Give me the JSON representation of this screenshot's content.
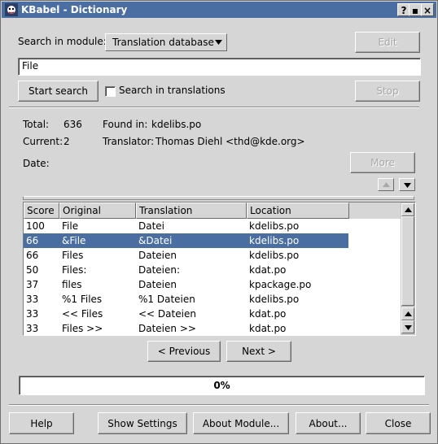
{
  "window": {
    "title": "KBabel - Dictionary",
    "title_buttons": [
      "?",
      "▪",
      "×"
    ]
  },
  "search": {
    "module_label": "Search in module:",
    "module_value": "Translation database",
    "query": "File",
    "edit_label": "Edit",
    "start_label": "Start search",
    "in_translations_label": "Search in translations",
    "in_translations_checked": false,
    "stop_label": "Stop"
  },
  "info": {
    "total_label": "Total:",
    "total_value": "636",
    "found_label": "Found in:",
    "found_value": "kdelibs.po",
    "current_label": "Current:",
    "current_value": "2",
    "translator_label": "Translator:",
    "translator_value": "Thomas Diehl <thd@kde.org>",
    "date_label": "Date:",
    "date_value": "",
    "more_label": "More"
  },
  "results": {
    "columns": [
      "Score",
      "Original",
      "Translation",
      "Location"
    ],
    "rows": [
      {
        "score": "100",
        "original": "File",
        "translation": "Datei",
        "location": "kdelibs.po",
        "selected": false
      },
      {
        "score": "66",
        "original": "&File",
        "translation": "&Datei",
        "location": "kdelibs.po",
        "selected": true
      },
      {
        "score": "66",
        "original": "Files",
        "translation": "Dateien",
        "location": "kdelibs.po",
        "selected": false
      },
      {
        "score": "50",
        "original": "Files:",
        "translation": "Dateien:",
        "location": "kdat.po",
        "selected": false
      },
      {
        "score": "37",
        "original": "files",
        "translation": "Dateien",
        "location": "kpackage.po",
        "selected": false
      },
      {
        "score": "33",
        "original": "%1 Files",
        "translation": "%1 Dateien",
        "location": "kdelibs.po",
        "selected": false
      },
      {
        "score": "33",
        "original": "<< Files",
        "translation": "<< Dateien",
        "location": "kdat.po",
        "selected": false
      },
      {
        "score": "33",
        "original": "Files >>",
        "translation": "Dateien >>",
        "location": "kdat.po",
        "selected": false
      }
    ]
  },
  "nav": {
    "previous_label": "< Previous",
    "next_label": "Next >"
  },
  "progress": {
    "text": "0%",
    "value": 0
  },
  "footer": {
    "help_label": "Help",
    "settings_label": "Show Settings",
    "about_module_label": "About Module...",
    "about_label": "About...",
    "close_label": "Close"
  },
  "colors": {
    "titlebar": "#4a6ea2",
    "selection": "#4a6ea2",
    "background": "#d6d6d6"
  }
}
